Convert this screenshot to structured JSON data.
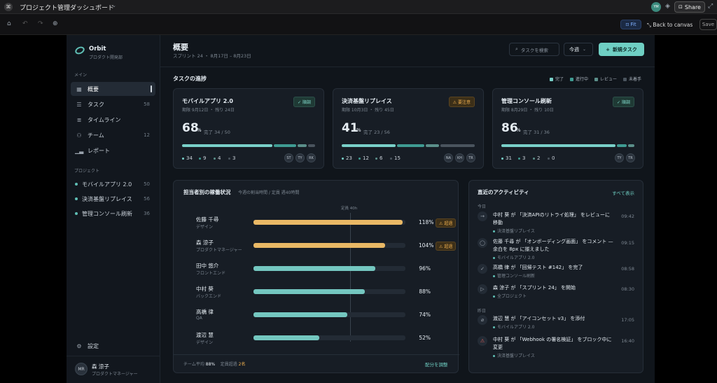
{
  "window": {
    "title": "プロジェクト管理ダッシュボード",
    "user_initials": "YM",
    "share_label": "Share"
  },
  "toolbar": {
    "fit_label": "Fit",
    "back_label": "Back to canvas",
    "save_label": "Save"
  },
  "brand": {
    "name": "Orbit",
    "subtitle": "プロダクト開発部"
  },
  "sidebar": {
    "section_main": "メイン",
    "items": [
      {
        "label": "概要",
        "count": ""
      },
      {
        "label": "タスク",
        "count": "58"
      },
      {
        "label": "タイムライン",
        "count": ""
      },
      {
        "label": "チーム",
        "count": "12"
      },
      {
        "label": "レポート",
        "count": ""
      }
    ],
    "section_projects": "プロジェクト",
    "projects": [
      {
        "label": "モバイルアプリ 2.0",
        "count": "50"
      },
      {
        "label": "決済基盤リプレイス",
        "count": "56"
      },
      {
        "label": "管理コンソール刷新",
        "count": "36"
      }
    ],
    "settings_label": "設定",
    "user": {
      "initials": "MR",
      "name": "森 涼子",
      "role": "プロダクトマネージャー"
    }
  },
  "header": {
    "title": "概要",
    "subtitle": "スプリント 24 ・ 8月17日 – 8月23日",
    "search_placeholder": "タスクを検索",
    "period": "今週",
    "new_task": "新規タスク"
  },
  "progress": {
    "title": "タスクの進捗",
    "legend": [
      "完了",
      "進行中",
      "レビュー",
      "未着手"
    ],
    "legend_colors": [
      "#79d0c8",
      "#3f9b92",
      "#5b8f8a",
      "#4a545e"
    ],
    "cards": [
      {
        "name": "モバイルアプリ 2.0",
        "badge": "順調",
        "status": "ok",
        "meta": "期限 9月12日 ・ 残り 24日",
        "pct": "68",
        "pct_unit": "%",
        "done_text": "完了 34 / 50",
        "counts": [
          "34",
          "9",
          "4",
          "3"
        ],
        "segments": [
          34,
          9,
          4,
          3
        ],
        "avatars": [
          "ST",
          "TY",
          "RK"
        ]
      },
      {
        "name": "決済基盤リプレイス",
        "badge": "要注意",
        "status": "warn",
        "meta": "期限 10月3日 ・ 残り 45日",
        "pct": "41",
        "pct_unit": "%",
        "done_text": "完了 23 / 56",
        "counts": [
          "23",
          "12",
          "6",
          "15"
        ],
        "segments": [
          23,
          12,
          6,
          15
        ],
        "avatars": [
          "NA",
          "KH",
          "TR"
        ]
      },
      {
        "name": "管理コンソール刷新",
        "badge": "順調",
        "status": "ok",
        "meta": "期限 8月29日 ・ 残り 10日",
        "pct": "86",
        "pct_unit": "%",
        "done_text": "完了 31 / 36",
        "counts": [
          "31",
          "3",
          "2",
          "0"
        ],
        "segments": [
          31,
          3,
          2,
          0
        ],
        "avatars": [
          "TY",
          "TR"
        ]
      }
    ]
  },
  "workload": {
    "title": "担当者別の稼働状況",
    "subtitle": "今週の割当時間 / 定員 週40時間",
    "capacity_label": "定員 40h",
    "rows": [
      {
        "name": "佐藤 千尋",
        "role": "デザイン",
        "pct_text": "118%",
        "value": 118,
        "over": "超過"
      },
      {
        "name": "森 涼子",
        "role": "プロダクトマネージャー",
        "pct_text": "104%",
        "value": 104,
        "over": "超過"
      },
      {
        "name": "田中 悠介",
        "role": "フロントエンド",
        "pct_text": "96%",
        "value": 96,
        "over": ""
      },
      {
        "name": "中村 葵",
        "role": "バックエンド",
        "pct_text": "88%",
        "value": 88,
        "over": ""
      },
      {
        "name": "高橋 律",
        "role": "QA",
        "pct_text": "74%",
        "value": 74,
        "over": ""
      },
      {
        "name": "渡辺 慧",
        "role": "デザイン",
        "pct_text": "52%",
        "value": 52,
        "over": ""
      }
    ],
    "footer_avg_label": "チーム平均",
    "footer_avg": "88%",
    "footer_over_label": "定員超過",
    "footer_over": "2名",
    "adjust": "配分を調整"
  },
  "activity": {
    "title": "直近のアクティビティ",
    "show_all": "すべて表示",
    "today": "今日",
    "yesterday": "昨日",
    "items": [
      {
        "icon": "arrow-right-icon",
        "glyph": "→",
        "text": "中村 葵 が 「決済APIのリトライ処理」 をレビューに移動",
        "project": "決済基盤リプレイス",
        "time": "09:42"
      },
      {
        "icon": "comment-icon",
        "glyph": "◯",
        "text": "佐藤 千尋 が 「オンボーディング画面」 をコメント — 余白を 8px に揃えました",
        "project": "モバイルアプリ 2.0",
        "time": "09:15"
      },
      {
        "icon": "check-icon",
        "glyph": "✓",
        "text": "高橋 律 が 「回帰テスト #142」 を完了",
        "project": "管理コンソール刷新",
        "time": "08:58"
      },
      {
        "icon": "play-icon",
        "glyph": "▷",
        "text": "森 涼子 が 「スプリント 24」 を開始",
        "project": "全プロジェクト",
        "time": "08:30"
      },
      {
        "icon": "paperclip-icon",
        "glyph": "⌀",
        "text": "渡辺 慧 が 「アイコンセット v3」 を添付",
        "project": "モバイルアプリ 2.0",
        "time": "17:05"
      },
      {
        "icon": "warning-icon",
        "glyph": "⚠",
        "text": "中村 葵 が 「Webhook の署名検証」 をブロック中に変更",
        "project": "決済基盤リプレイス",
        "time": "16:40"
      }
    ]
  }
}
